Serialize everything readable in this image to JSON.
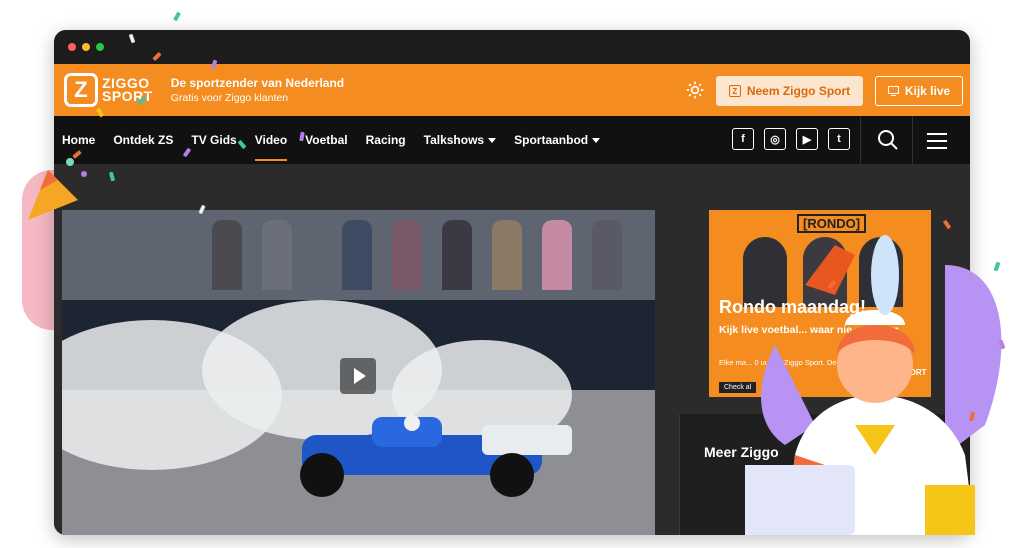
{
  "brand": {
    "logo_top": "ZIGGO",
    "logo_bottom": "SPORT",
    "logo_mark": "Z",
    "tagline": "De sportzender van Nederland",
    "subtagline": "Gratis voor Ziggo klanten",
    "accent": "#f48c1f"
  },
  "header": {
    "settings_icon": "gear-icon",
    "neem_label": "Neem Ziggo Sport",
    "live_label": "Kijk live"
  },
  "nav": {
    "items": [
      {
        "label": "Home"
      },
      {
        "label": "Ontdek ZS"
      },
      {
        "label": "TV Gids"
      },
      {
        "label": "Video"
      },
      {
        "label": "Voetbal"
      },
      {
        "label": "Racing"
      },
      {
        "label": "Talkshows"
      },
      {
        "label": "Sportaanbod"
      }
    ],
    "socials": [
      "f",
      "◎",
      "▶",
      "t"
    ]
  },
  "ad": {
    "label": "[RONDO]",
    "title": "Rondo maandag!",
    "sub": "Kijk live voetbal... waar nie... proken",
    "small": "Elke ma... 0 uur op Ziggo Sport. De... aan Nederland",
    "button": "Check al",
    "logo": "SPORT"
  },
  "meer": {
    "title": "Meer Ziggo"
  }
}
